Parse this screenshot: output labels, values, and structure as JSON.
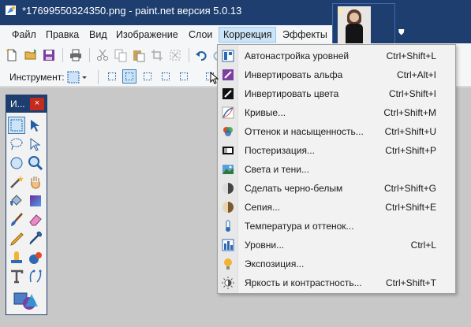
{
  "window": {
    "title": "*17699550324350.png - paint.net версия 5.0.13"
  },
  "menu": [
    {
      "label": "Файл"
    },
    {
      "label": "Правка"
    },
    {
      "label": "Вид"
    },
    {
      "label": "Изображение"
    },
    {
      "label": "Слои"
    },
    {
      "label": "Коррекция",
      "active": true
    },
    {
      "label": "Эффекты"
    }
  ],
  "toolbar": {
    "tool_label": "Инструмент:"
  },
  "tools_window": {
    "title": "И...",
    "close": "×"
  },
  "adjustments_menu": [
    {
      "label": "Автонастройка уровней",
      "shortcut": "Ctrl+Shift+L",
      "icon": "auto-level-icon"
    },
    {
      "label": "Инвертировать альфа",
      "shortcut": "Ctrl+Alt+I",
      "icon": "invert-alpha-icon"
    },
    {
      "label": "Инвертировать цвета",
      "shortcut": "Ctrl+Shift+I",
      "icon": "invert-colors-icon"
    },
    {
      "label": "Кривые...",
      "shortcut": "Ctrl+Shift+M",
      "icon": "curves-icon"
    },
    {
      "label": "Оттенок и насыщенность...",
      "shortcut": "Ctrl+Shift+U",
      "icon": "hue-saturation-icon"
    },
    {
      "label": "Постеризация...",
      "shortcut": "Ctrl+Shift+P",
      "icon": "posterize-icon"
    },
    {
      "label": "Света и тени...",
      "shortcut": "",
      "icon": "shadows-highlights-icon"
    },
    {
      "label": "Сделать черно-белым",
      "shortcut": "Ctrl+Shift+G",
      "icon": "black-white-icon"
    },
    {
      "label": "Сепия...",
      "shortcut": "Ctrl+Shift+E",
      "icon": "sepia-icon"
    },
    {
      "label": "Температура и оттенок...",
      "shortcut": "",
      "icon": "temperature-icon"
    },
    {
      "label": "Уровни...",
      "shortcut": "Ctrl+L",
      "icon": "levels-icon"
    },
    {
      "label": "Экспозиция...",
      "shortcut": "",
      "icon": "exposure-icon"
    },
    {
      "label": "Яркость и контрастность...",
      "shortcut": "Ctrl+Shift+T",
      "icon": "brightness-contrast-icon"
    }
  ],
  "colors": {
    "titlebar": "#1d3e6e",
    "menu_highlight": "#cce4f7",
    "close_red": "#c42b1c",
    "canvas_bg": "#c8c8c8"
  }
}
